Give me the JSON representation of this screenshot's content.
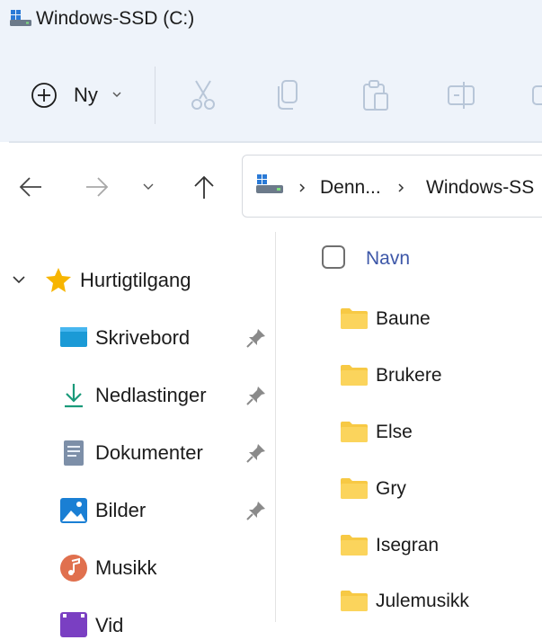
{
  "window": {
    "title": "Windows-SSD (C:)"
  },
  "toolbar": {
    "new_label": "Ny",
    "icons": [
      "cut-icon",
      "copy-icon",
      "paste-icon",
      "rename-icon"
    ]
  },
  "nav": {
    "breadcrumbs": [
      "Denn...",
      "Windows-SS"
    ]
  },
  "sidebar": {
    "quick_access_label": "Hurtigtilgang",
    "items": [
      {
        "label": "Skrivebord",
        "icon": "desktop-icon",
        "pinned": true
      },
      {
        "label": "Nedlastinger",
        "icon": "download-icon",
        "pinned": true
      },
      {
        "label": "Dokumenter",
        "icon": "document-icon",
        "pinned": true
      },
      {
        "label": "Bilder",
        "icon": "pictures-icon",
        "pinned": true
      },
      {
        "label": "Musikk",
        "icon": "music-icon",
        "pinned": false
      },
      {
        "label": "Vid",
        "icon": "video-icon",
        "pinned": false
      }
    ]
  },
  "main": {
    "column_header": "Navn",
    "folders": [
      "Baune",
      "Brukere",
      "Else",
      "Gry",
      "Isegran",
      "Julemusikk"
    ]
  },
  "colors": {
    "chrome_bg": "#eef3fa",
    "header_text": "#3d57a8",
    "folder_yellow": "#f7c944",
    "download_green": "#1a9a7a",
    "star_yellow": "#f7b500"
  }
}
